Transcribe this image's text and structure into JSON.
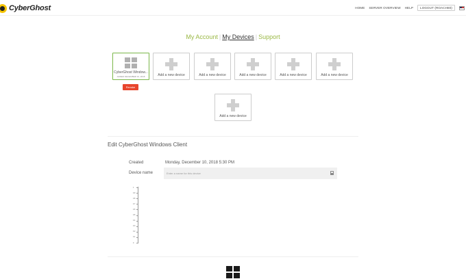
{
  "brand": {
    "name": "CyberGhost"
  },
  "topnav": {
    "home": "HOME",
    "server_overview": "SERVER OVERVIEW",
    "help": "HELP",
    "logout": "LOGOUT (ROACH80)"
  },
  "account_tabs": {
    "my_account": "My Account",
    "my_devices": "My Devices",
    "support": "Support"
  },
  "devices": [
    {
      "label": "CyberGhost Window...",
      "sublabel": "ADDED DECEMBER 10, 2018",
      "icon": "windows-icon",
      "selected": true
    },
    {
      "label": "Add a new device",
      "icon": "plus-icon"
    },
    {
      "label": "Add a new device",
      "icon": "plus-icon"
    },
    {
      "label": "Add a new device",
      "icon": "plus-icon"
    },
    {
      "label": "Add a new device",
      "icon": "plus-icon"
    },
    {
      "label": "Add a new device",
      "icon": "plus-icon"
    },
    {
      "label": "Add a new device",
      "icon": "plus-icon"
    }
  ],
  "revoke_button": "Revoke",
  "edit": {
    "title": "Edit CyberGhost Windows Client",
    "created_label": "Created",
    "created_value": "Monday, December 10, 2018 5:30 PM",
    "device_name_label": "Device name",
    "device_name_placeholder": "Enter a name for this device"
  },
  "traffic_axis": {
    "ticks": [
      "1",
      "0.9",
      "0.8",
      "0.7",
      "0.6",
      "0.5",
      "0.4",
      "0.3",
      "0.2",
      "0.1",
      "0"
    ]
  },
  "colors": {
    "accent_green": "#9ab845",
    "selected_border": "#7ab648",
    "revoke_red": "#e8452c",
    "logo_yellow": "#f5c400"
  }
}
